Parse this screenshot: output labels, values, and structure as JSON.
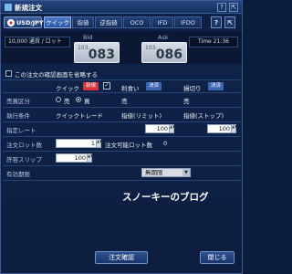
{
  "window": {
    "title": "新規注文",
    "help_label": "?",
    "popout_label": "⇱"
  },
  "pair": {
    "label": "USD/JPY"
  },
  "tabs": [
    {
      "label": "クイック",
      "active": true
    },
    {
      "label": "指値",
      "active": false
    },
    {
      "label": "逆指値",
      "active": false
    },
    {
      "label": "OCO",
      "active": false
    },
    {
      "label": "IFD",
      "active": false
    },
    {
      "label": "IFDO",
      "active": false
    }
  ],
  "quote": {
    "lot_label": "10,000 通貨 / ロット",
    "time_label": "Time",
    "time_value": "21:36",
    "bid_label": "Bid",
    "ask_label": "Ask",
    "bid_prefix": "103.",
    "bid_big": "083",
    "ask_prefix": "103.",
    "ask_big": "086"
  },
  "confirm_skip": {
    "label": "この注文の確認画面を省略する",
    "checked": false
  },
  "columns": {
    "quick": {
      "label": "クイック",
      "badge": "新規",
      "badge_color": "#d9323a"
    },
    "limit": {
      "label": "利食い",
      "badge": "決済",
      "badge_color": "#3a66b3"
    },
    "stop": {
      "label": "損切り",
      "badge": "決済",
      "badge_color": "#3a66b3"
    }
  },
  "rows": {
    "side": {
      "label": "売買区分",
      "sell": "売",
      "buy": "買",
      "selected": "買",
      "limit_value": "売",
      "stop_value": "売"
    },
    "condition": {
      "label": "執行条件",
      "quick": "クイックトレード",
      "limit": "指値(リミット)",
      "stop": "指値(ストップ)"
    },
    "rate": {
      "label": "指定レート",
      "limit_value": "100",
      "stop_value": "100"
    },
    "lots": {
      "label": "注文ロット数",
      "value": "1",
      "available_label": "注文可能ロット数",
      "available_value": "0"
    },
    "slippage": {
      "label": "許容スリップ",
      "value": "100"
    },
    "expiry": {
      "label": "有効期限",
      "value": "無期限"
    }
  },
  "watermark": "スノーキーのブログ",
  "buttons": {
    "confirm": "注文確認",
    "close": "閉じる"
  }
}
